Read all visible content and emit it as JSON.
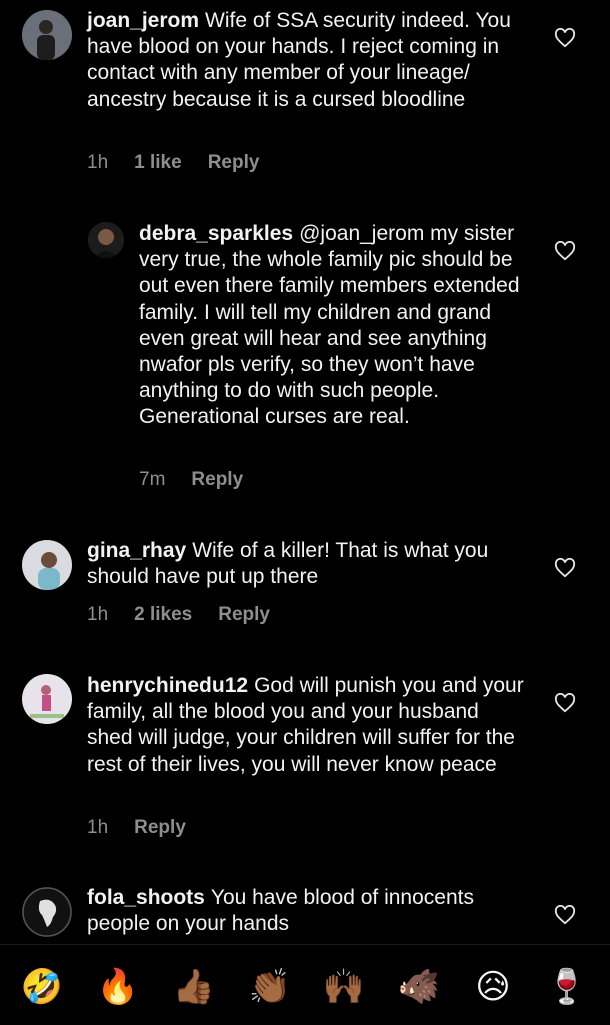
{
  "comments": [
    {
      "user": "joan_jerom",
      "text": "Wife of SSA security indeed. You have blood on your hands. I reject coming in contact with any member of your lineage/ ancestry because it is a cursed bloodline",
      "time": "1h",
      "likes": "1 like",
      "reply": "Reply"
    },
    {
      "user": "debra_sparkles",
      "text": "@joan_jerom my sister very true, the whole family pic should be out even there family members extended family. I will tell my children and grand even great will hear and see anything nwafor pls verify,  so they won’t have anything to do with such people. Generational curses are real.",
      "time": "7m",
      "reply": "Reply"
    },
    {
      "user": "gina_rhay",
      "text": "Wife of a killer! That is what you should have put up there",
      "time": "1h",
      "likes": "2 likes",
      "reply": "Reply"
    },
    {
      "user": "henrychinedu12",
      "text": "God will punish you and your family, all the blood you and your husband shed will judge, your children will suffer for the rest of their lives, you will never know peace",
      "time": "1h",
      "reply": "Reply"
    },
    {
      "user": "fola_shoots",
      "text": "You have blood of innocents people on your hands"
    }
  ],
  "emoji_bar": [
    {
      "name": "rofl-emoji",
      "char": "🤣"
    },
    {
      "name": "fire-emoji",
      "char": "🔥"
    },
    {
      "name": "thumbs-up-emoji",
      "char": "👍🏾"
    },
    {
      "name": "clapping-emoji",
      "char": "👏🏾"
    },
    {
      "name": "raised-hands-emoji",
      "char": "🙌🏾"
    },
    {
      "name": "boar-emoji",
      "char": "🐗"
    },
    {
      "name": "sad-relieved-emoji",
      "char": "😥"
    },
    {
      "name": "wine-glass-emoji",
      "char": "🍷"
    }
  ],
  "colors": {
    "background": "#000000",
    "meta": "#8e8e8e",
    "text": "#f2f2f2"
  }
}
